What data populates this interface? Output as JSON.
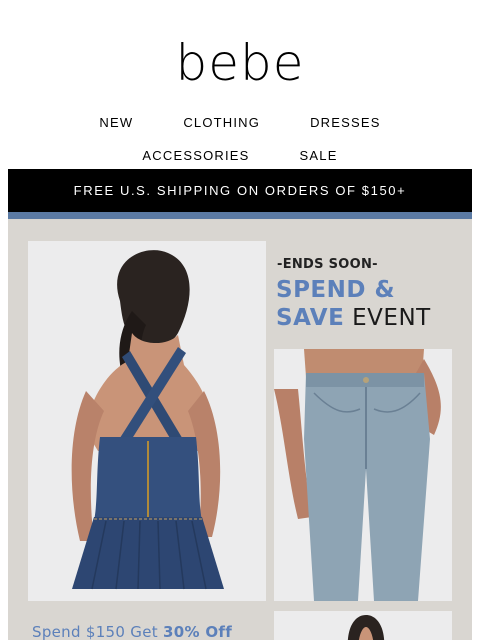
{
  "brand": {
    "logo_text": "bebe"
  },
  "nav": {
    "row1": [
      "NEW",
      "CLOTHING",
      "DRESSES"
    ],
    "row2": [
      "ACCESSORIES",
      "SALE"
    ]
  },
  "promo_bar": {
    "text": "FREE U.S. SHIPPING ON ORDERS OF $150+"
  },
  "hero": {
    "kicker": "-ENDS SOON-",
    "headline_line1": "SPEND &",
    "headline_line2_accent": "SAVE",
    "headline_line2_rest": " EVENT",
    "offer_prefix": "Spend $150 Get ",
    "offer_accent": "30% Off"
  },
  "colors": {
    "accent": "#5c80ba",
    "strip": "#5b7aa3",
    "hero_bg": "#d9d6d1",
    "bar": "#000000"
  }
}
